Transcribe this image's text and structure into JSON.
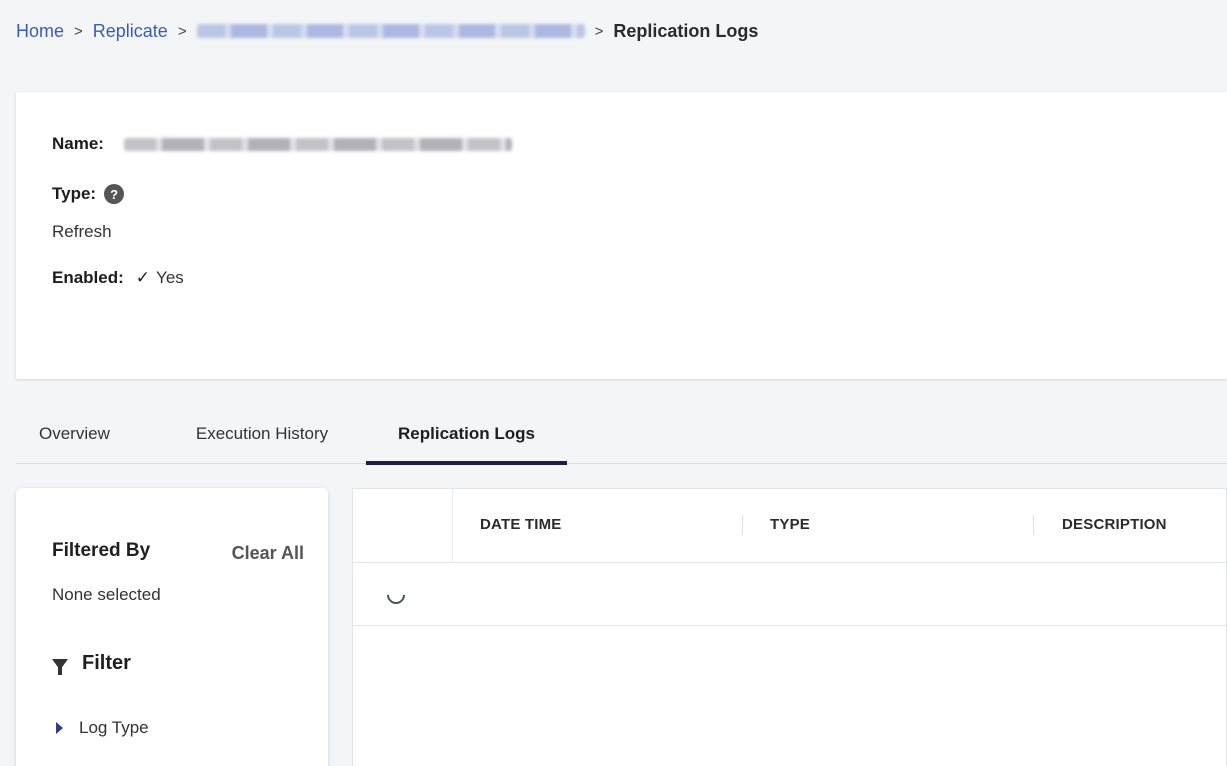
{
  "breadcrumb": {
    "home": "Home",
    "replicate": "Replicate",
    "current": "Replication Logs",
    "separator": ">"
  },
  "details": {
    "name_label": "Name:",
    "type_label": "Type:",
    "type_value": "Refresh",
    "enabled_label": "Enabled:",
    "enabled_value": "Yes",
    "help_icon": "?",
    "check_icon": "✓"
  },
  "tabs": [
    {
      "label": "Overview",
      "active": false
    },
    {
      "label": "Execution History",
      "active": false
    },
    {
      "label": "Replication Logs",
      "active": true
    }
  ],
  "filter": {
    "title": "Filtered By",
    "clear_all": "Clear All",
    "none_selected": "None selected",
    "heading": "Filter",
    "items": [
      {
        "label": "Log Type",
        "icon": "caret-right-icon"
      }
    ]
  },
  "table": {
    "columns": [
      "DATE TIME",
      "TYPE",
      "DESCRIPTION"
    ],
    "loading": true
  },
  "colors": {
    "link": "#3d5bb5",
    "active_tab_underline": "#1f1b4c",
    "page_background": "#f4f5f7"
  }
}
